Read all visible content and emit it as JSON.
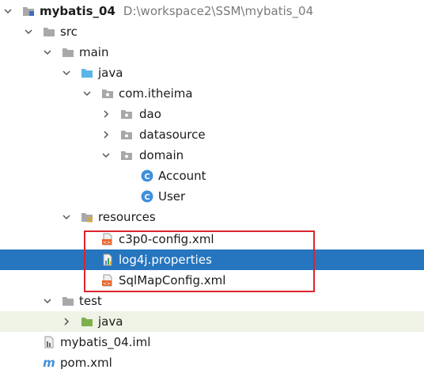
{
  "project": {
    "name": "mybatis_04",
    "path": "D:\\workspace2\\SSM\\mybatis_04"
  },
  "tree": {
    "src": "src",
    "main": "main",
    "java": "java",
    "package": "com.itheima",
    "dao": "dao",
    "datasource": "datasource",
    "domain": "domain",
    "account": "Account",
    "user": "User",
    "resources": "resources",
    "c3p0": "c3p0-config.xml",
    "log4j": "log4j.properties",
    "sqlmap": "SqlMapConfig.xml",
    "test": "test",
    "test_java": "java",
    "iml": "mybatis_04.iml",
    "pom": "pom.xml"
  },
  "selected_item": "log4j.properties",
  "icons": {
    "arrow_expanded": "chevron-down-icon",
    "arrow_collapsed": "chevron-right-icon",
    "folder": "folder-icon",
    "source_folder": "source-folder-icon",
    "resources_folder": "resources-folder-icon",
    "test_folder": "test-source-folder-icon",
    "package": "package-icon",
    "class": "class-icon",
    "xml": "xml-file-icon",
    "properties": "properties-file-icon",
    "iml": "iml-file-icon",
    "maven": "maven-pom-icon"
  },
  "colors": {
    "selection": "#2675bf",
    "highlight_box": "#d9262c",
    "test_row_tint": "#eef3e6",
    "folder": "#a8a8a8",
    "source_folder": "#5ab6e6",
    "test_folder": "#7fb14a",
    "class_icon": "#3f8fdc",
    "xml_icon": "#e8662f"
  }
}
